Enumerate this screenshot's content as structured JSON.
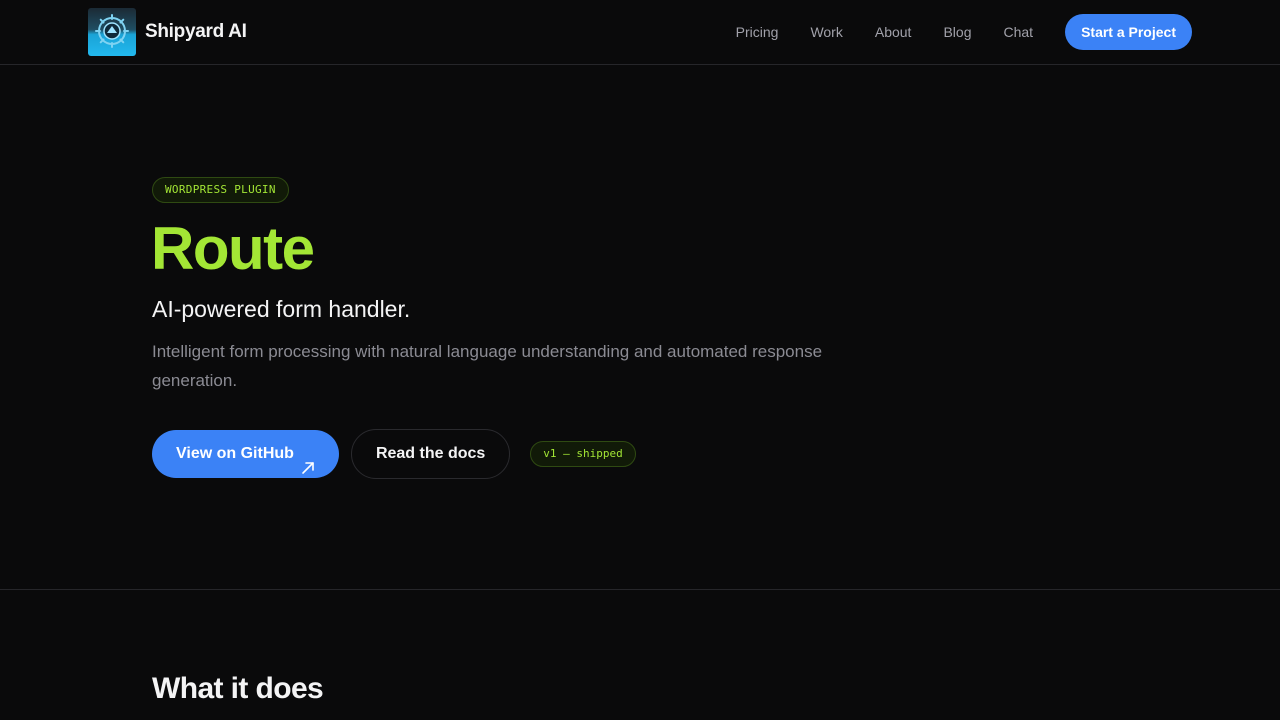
{
  "header": {
    "brand_name": "Shipyard AI",
    "logo_icon": "shipyard-logo-icon",
    "nav": [
      {
        "label": "Pricing"
      },
      {
        "label": "Work"
      },
      {
        "label": "About"
      },
      {
        "label": "Blog"
      },
      {
        "label": "Chat"
      }
    ],
    "cta_label": "Start a Project"
  },
  "hero": {
    "badge": "WORDPRESS PLUGIN",
    "title": "Route",
    "tagline": "AI-powered form handler.",
    "description": "Intelligent form processing with natural language understanding and automated response generation.",
    "primary_button": "View on GitHub",
    "primary_button_icon": "arrow-up-right-icon",
    "secondary_button": "Read the docs",
    "status": "v1 — shipped"
  },
  "section": {
    "title": "What it does"
  },
  "colors": {
    "background": "#0a0a0b",
    "accent_green": "#a3e635",
    "accent_blue": "#3b82f6",
    "muted_text": "#8b8b93",
    "border": "#26262a"
  }
}
